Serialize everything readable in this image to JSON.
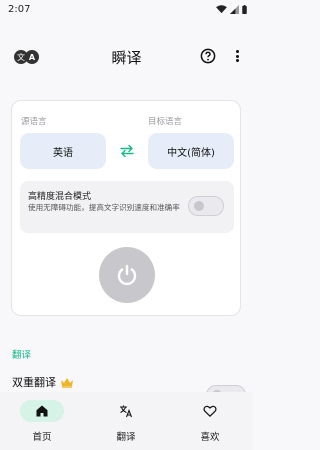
{
  "status_bar": {
    "time": "2:07"
  },
  "app_bar": {
    "title": "瞬译",
    "logo_left": "文",
    "logo_right": "A"
  },
  "card": {
    "source_label": "源语言",
    "target_label": "目标语言",
    "source_lang": "英语",
    "target_lang": "中文(简体)",
    "hp_title": "高精度混合模式",
    "hp_desc": "使用无障碍功能，提高文字识别速度和准确率",
    "hp_enabled": false
  },
  "translate_section": {
    "header": "翻译",
    "dual_label": "双重翻译",
    "dual_enabled": false
  },
  "bottom_nav": {
    "items": [
      {
        "label": "首页",
        "icon": "home-icon",
        "active": true
      },
      {
        "label": "翻译",
        "icon": "translate-icon",
        "active": false
      },
      {
        "label": "喜欢",
        "icon": "heart-icon",
        "active": false
      }
    ]
  },
  "colors": {
    "accent": "#19b88a",
    "lang_button_bg": "#e6edf8",
    "power_button_bg": "#c8c8cc",
    "active_nav_pill": "#d6f3e7",
    "crown": "#f0b429"
  }
}
